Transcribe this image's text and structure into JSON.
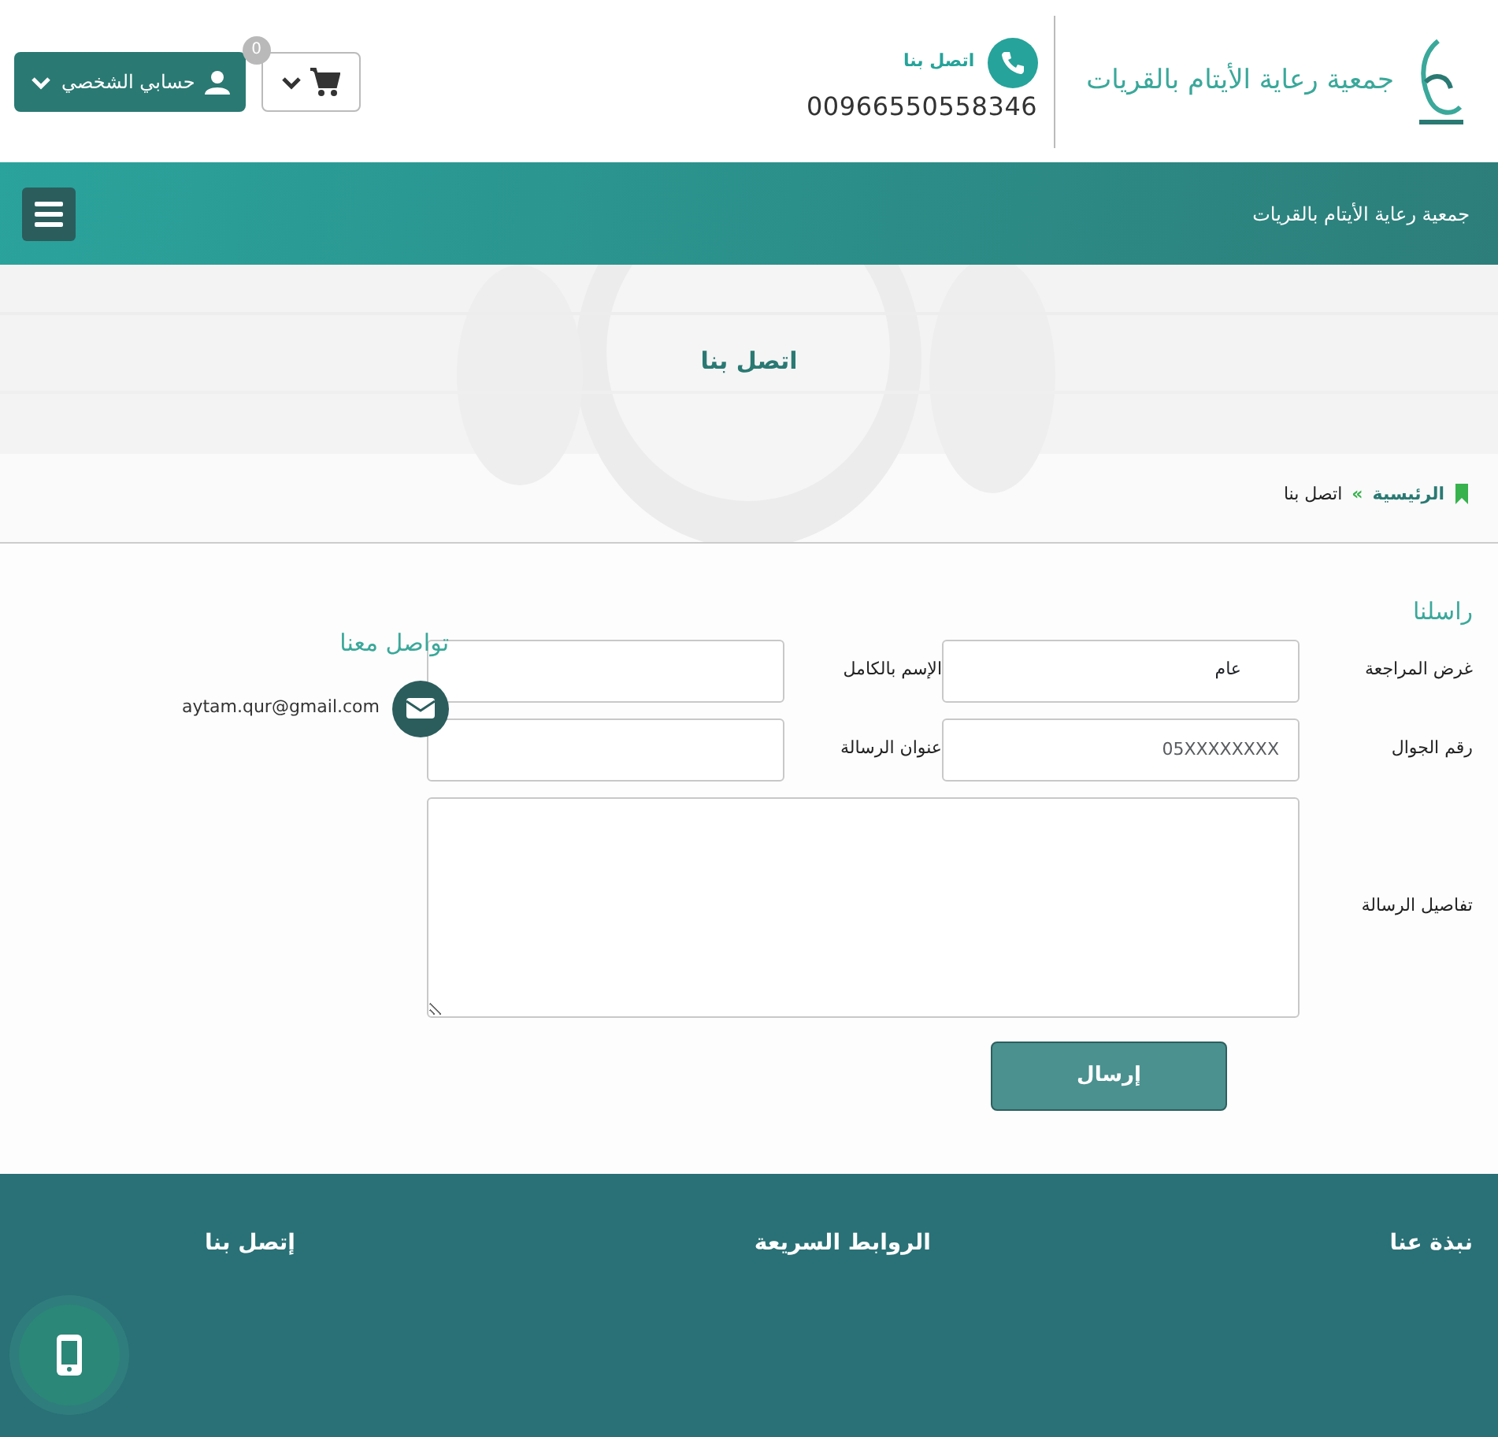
{
  "header": {
    "logo_text": "جمعية رعاية الأيتام بالقريات",
    "contact_label": "اتصل بنا",
    "phone": "00966550558346",
    "cart_count": "0",
    "account_button": "حسابي الشخصي"
  },
  "navbar": {
    "brand": "جمعية رعاية الأيتام بالقريات"
  },
  "hero": {
    "title": "اتصل بنا",
    "breadcrumb": [
      {
        "label": "الرئيسية",
        "kind": "link"
      },
      {
        "label": "»",
        "kind": "separator"
      },
      {
        "label": "اتصل بنا",
        "kind": "current"
      }
    ]
  },
  "form": {
    "title": "راسلنا",
    "fields": [
      {
        "label": "غرض المراجعة",
        "kind": "select",
        "value": "عام"
      },
      {
        "label": "الإسم بالكامل",
        "kind": "text"
      },
      {
        "label": "رقم الجوال",
        "kind": "text",
        "placeholder": "05XXXXXXXX"
      },
      {
        "label": "عنوان الرسالة",
        "kind": "text"
      },
      {
        "label": "تفاصيل الرسالة",
        "kind": "textarea"
      }
    ],
    "submit": "إرسال"
  },
  "contact": {
    "title": "تواصل معنا",
    "email": "aytam.qur@gmail.com"
  },
  "footer": {
    "headings": [
      "نبذة عنا",
      "الروابط السريعة",
      "إتصل بنا"
    ]
  }
}
